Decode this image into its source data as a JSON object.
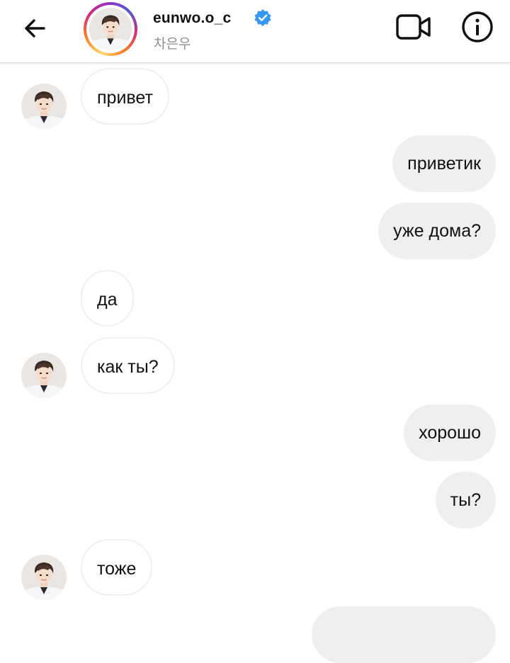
{
  "header": {
    "username": "eunwo.o_c",
    "display_name": "차은우",
    "verified": true,
    "icons": [
      "back-arrow-icon",
      "verified-badge-icon",
      "video-call-icon",
      "info-icon"
    ]
  },
  "messages": [
    {
      "from": "them",
      "text": "привет",
      "avatar": true
    },
    {
      "from": "me",
      "text": "приветик"
    },
    {
      "from": "me",
      "text": "уже дома?"
    },
    {
      "from": "them",
      "text": "да",
      "avatar": false
    },
    {
      "from": "them",
      "text": "как ты?",
      "avatar": true
    },
    {
      "from": "me",
      "text": "хорошо"
    },
    {
      "from": "me",
      "text": "ты?"
    },
    {
      "from": "them",
      "text": "тоже",
      "avatar": true
    }
  ],
  "colors": {
    "outgoing_bubble": "#efefef",
    "incoming_border": "#efefef",
    "verified_blue": "#3897f0",
    "secondary_text": "#8e8e8e"
  }
}
